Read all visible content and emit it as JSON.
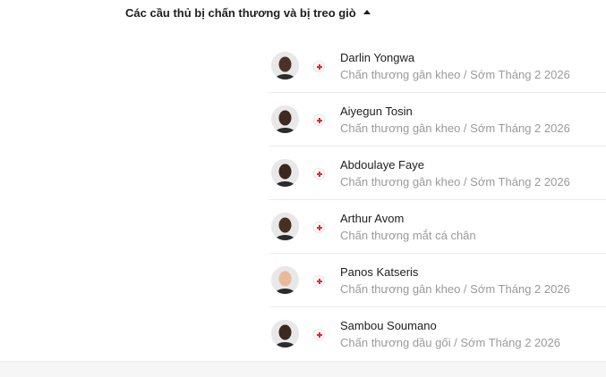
{
  "section": {
    "title": "Các cầu thủ bị chấn thương và bị treo giò",
    "toggle_icon": "chevron-up-icon"
  },
  "players": [
    {
      "name": "Darlin Yongwa",
      "status": "Chấn thương gân kheo / Sớm Tháng 2 2026",
      "skin": "#4a3226",
      "status_icon": "injury-cross-icon"
    },
    {
      "name": "Aiyegun Tosin",
      "status": "Chấn thương gân kheo / Sớm Tháng 2 2026",
      "skin": "#3f2a20",
      "status_icon": "injury-cross-icon"
    },
    {
      "name": "Abdoulaye Faye",
      "status": "Chấn thương gân kheo / Sớm Tháng 2 2026",
      "skin": "#3a271d",
      "status_icon": "injury-cross-icon"
    },
    {
      "name": "Arthur Avom",
      "status": "Chấn thương mắt cá chân",
      "skin": "#46301f",
      "status_icon": "injury-cross-icon"
    },
    {
      "name": "Panos Katseris",
      "status": "Chấn thương gân kheo / Sớm Tháng 2 2026",
      "skin": "#e9b99a",
      "status_icon": "injury-cross-icon"
    },
    {
      "name": "Sambou Soumano",
      "status": "Chấn thương dầu gối / Sớm Tháng 2 2026",
      "skin": "#3c281e",
      "status_icon": "injury-cross-icon"
    }
  ],
  "colors": {
    "injury_red": "#e02b2b",
    "secondary_text": "#9a9a9a"
  }
}
